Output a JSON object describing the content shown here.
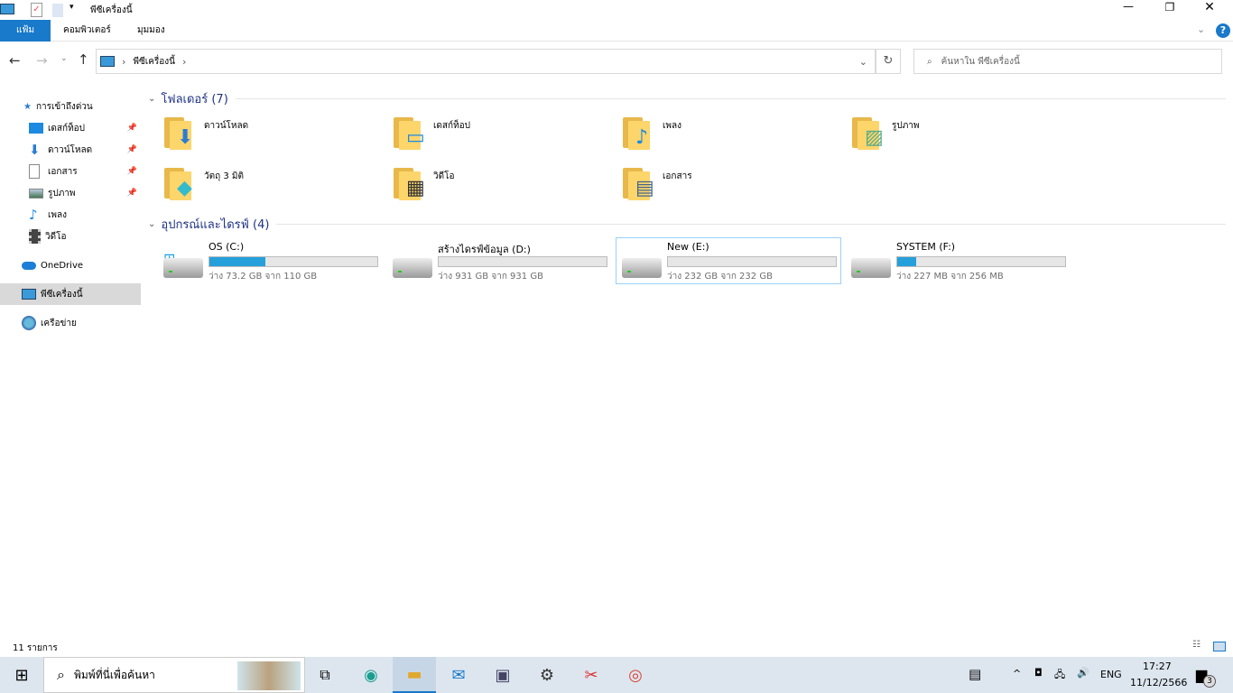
{
  "window": {
    "title": "พีซีเครื่องนี้"
  },
  "ribbon": {
    "tabs": [
      "แฟ้ม",
      "คอมพิวเตอร์",
      "มุมมอง"
    ]
  },
  "nav": {
    "breadcrumb": "พีซีเครื่องนี้",
    "search_placeholder": "ค้นหาใน พีซีเครื่องนี้"
  },
  "sidebar": {
    "quick_access": "การเข้าถึงด่วน",
    "items": [
      {
        "label": "เดสก์ท็อป",
        "pinned": true
      },
      {
        "label": "ดาวน์โหลด",
        "pinned": true
      },
      {
        "label": "เอกสาร",
        "pinned": true
      },
      {
        "label": "รูปภาพ",
        "pinned": true
      },
      {
        "label": "เพลง",
        "pinned": false
      },
      {
        "label": "วิดีโอ",
        "pinned": false
      }
    ],
    "onedrive": "OneDrive",
    "this_pc": "พีซีเครื่องนี้",
    "network": "เครือข่าย"
  },
  "folders": {
    "header": "โฟลเดอร์ (7)",
    "items": [
      "ดาวน์โหลด",
      "เดสก์ท็อป",
      "เพลง",
      "รูปภาพ",
      "วัตถุ 3 มิติ",
      "วิดีโอ",
      "เอกสาร"
    ]
  },
  "drives": {
    "header": "อุปกรณ์และไดรฟ์ (4)",
    "items": [
      {
        "name": "OS (C:)",
        "free": "ว่าง 73.2 GB จาก 110 GB",
        "used_fraction": 0.335
      },
      {
        "name": "สร้างไดรฟ์ข้อมูล (D:)",
        "free": "ว่าง 931 GB จาก 931 GB",
        "used_fraction": 0
      },
      {
        "name": "New (E:)",
        "free": "ว่าง 232 GB จาก 232 GB",
        "used_fraction": 0
      },
      {
        "name": "SYSTEM (F:)",
        "free": "ว่าง 227 MB จาก 256 MB",
        "used_fraction": 0.113
      }
    ]
  },
  "status": {
    "count": "11 รายการ"
  },
  "taskbar": {
    "search_placeholder": "พิมพ์ที่นี่เพื่อค้นหา",
    "lang": "ENG",
    "time": "17:27",
    "date": "11/12/2566",
    "notifications": "3"
  },
  "colors": {
    "accent": "#0063b1",
    "bar": "#26a0da",
    "group": "#1e3287"
  }
}
